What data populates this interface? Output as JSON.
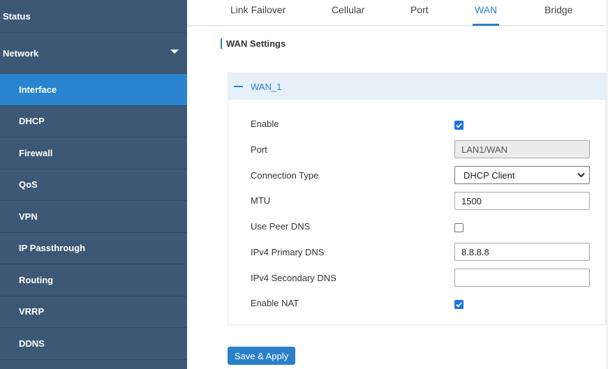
{
  "sidebar": {
    "status_label": "Status",
    "network_label": "Network",
    "items": [
      {
        "label": "Interface"
      },
      {
        "label": "DHCP"
      },
      {
        "label": "Firewall"
      },
      {
        "label": "QoS"
      },
      {
        "label": "VPN"
      },
      {
        "label": "IP Passthrough"
      },
      {
        "label": "Routing"
      },
      {
        "label": "VRRP"
      },
      {
        "label": "DDNS"
      }
    ],
    "active_item": "Interface"
  },
  "tabs": [
    {
      "label": "Link Failover"
    },
    {
      "label": "Cellular"
    },
    {
      "label": "Port"
    },
    {
      "label": "WAN"
    },
    {
      "label": "Bridge"
    }
  ],
  "active_tab": "WAN",
  "section": {
    "title": "WAN Settings"
  },
  "panel": {
    "title": "WAN_1",
    "fields": {
      "enable": {
        "label": "Enable",
        "checked": true
      },
      "port": {
        "label": "Port",
        "value": "LAN1/WAN"
      },
      "connection_type": {
        "label": "Connection Type",
        "value": "DHCP Client"
      },
      "mtu": {
        "label": "MTU",
        "value": "1500"
      },
      "use_peer_dns": {
        "label": "Use Peer DNS",
        "checked": false
      },
      "ipv4_primary_dns": {
        "label": "IPv4 Primary DNS",
        "value": "8.8.8.8"
      },
      "ipv4_secondary_dns": {
        "label": "IPv4 Secondary DNS",
        "value": ""
      },
      "enable_nat": {
        "label": "Enable NAT",
        "checked": true
      }
    }
  },
  "actions": {
    "save_label": "Save & Apply"
  },
  "colors": {
    "sidebar_bg": "#3c5874",
    "active_item_bg": "#2a84cf",
    "accent": "#2a7fc8",
    "checkbox_on": "#1a73e8"
  },
  "icons": {
    "network_caret": "caret-down-icon",
    "panel_collapse": "minus-icon",
    "select_arrow": "chevron-down-icon",
    "checkbox_check": "check-icon"
  }
}
